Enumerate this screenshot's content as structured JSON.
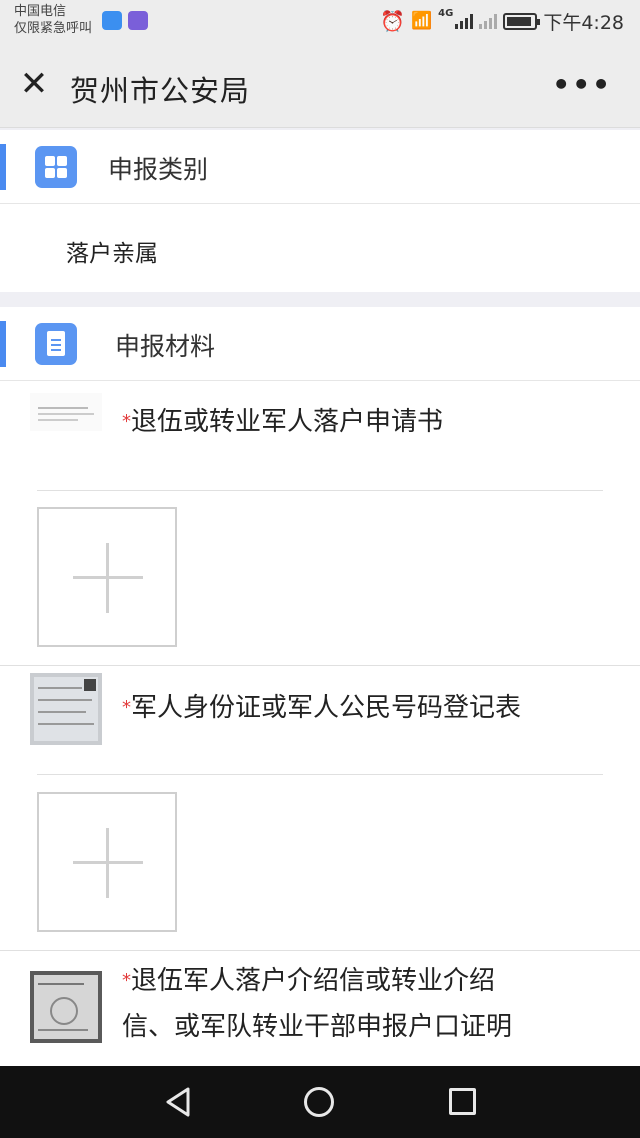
{
  "status_bar": {
    "carrier": "中国电信",
    "carrier_note": "仅限紧急呼叫",
    "network": "4G",
    "time": "下午4:28"
  },
  "header": {
    "title": "贺州市公安局",
    "close_icon": "close-icon",
    "more_icon": "more-dots-icon",
    "more_glyph": "•••"
  },
  "category_section": {
    "title": "申报类别",
    "icon": "grid-icon",
    "value": "落户亲属"
  },
  "materials_section": {
    "title": "申报材料",
    "icon": "document-icon",
    "items": [
      {
        "label": "退伍或转业军人落户申请书",
        "required_mark": "*"
      },
      {
        "label": "军人身份证或军人公民号码登记表",
        "required_mark": "*"
      },
      {
        "label": "退伍军人落户介绍信或转业介绍",
        "label_line2": "信、或军队转业干部申报户口证明",
        "required_mark": "*"
      }
    ]
  },
  "colors": {
    "accent": "#4a8af0",
    "required": "#e23b3b",
    "nav_bg": "#111111"
  }
}
